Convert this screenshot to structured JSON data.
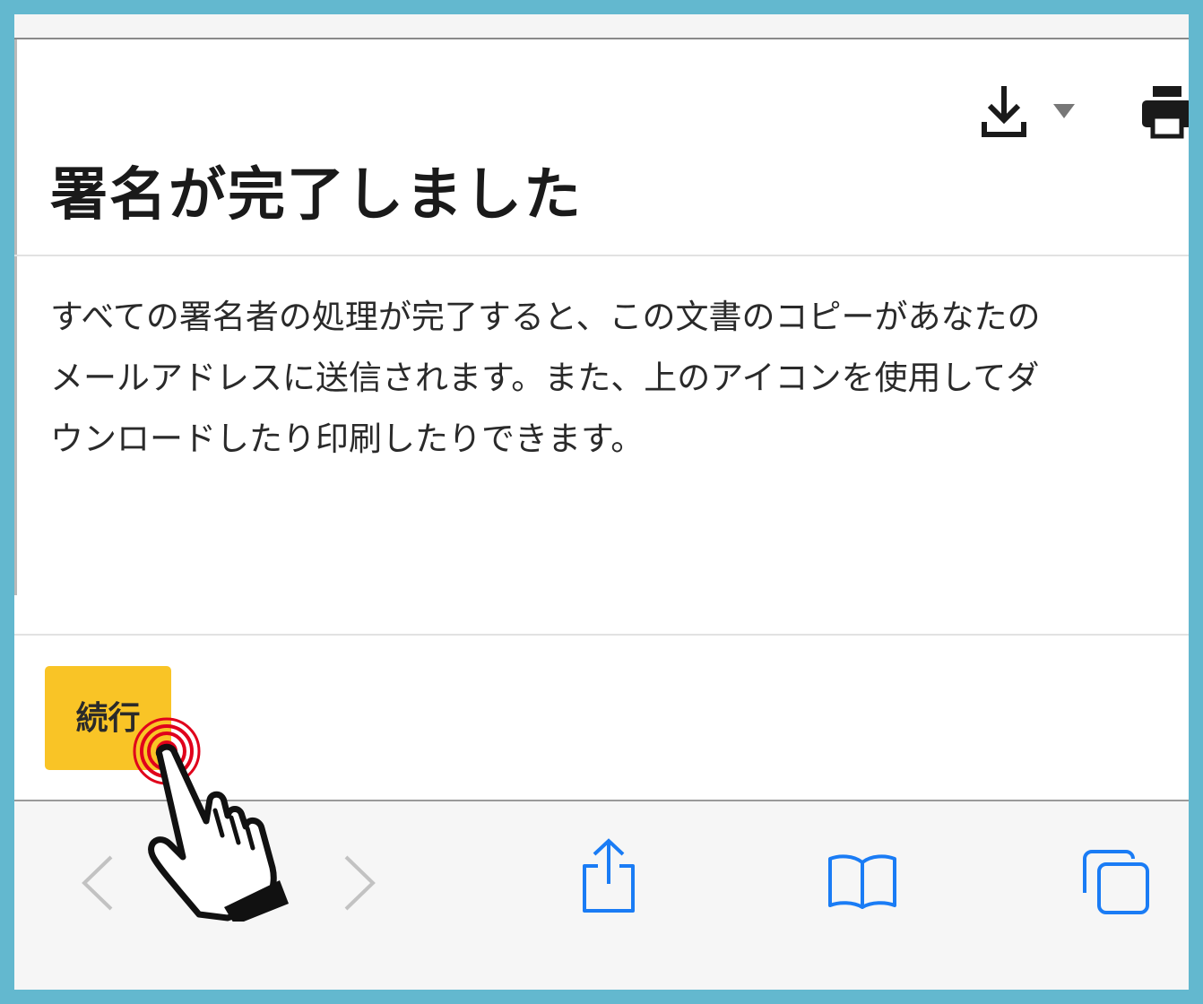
{
  "page": {
    "title": "署名が完了しました",
    "message_lines": [
      "すべての署名者の処理が完了すると、この文書のコピーがあなたの",
      "メールアドレスに送信されます。また、上のアイコンを使用してダ",
      "ウンロードしたり印刷したりできます。"
    ]
  },
  "toolbar": {
    "icons": [
      "download-icon",
      "dropdown-caret-icon",
      "print-icon"
    ]
  },
  "continue_button": {
    "label": "続行",
    "color": "#f9c426"
  },
  "browser_bar": {
    "icons": [
      "back-chevron-icon",
      "forward-chevron-icon",
      "share-icon",
      "bookmarks-icon",
      "tabs-icon"
    ],
    "accent": "#1a7cf5"
  },
  "tap_indicator": {
    "color": "#e0001b"
  }
}
